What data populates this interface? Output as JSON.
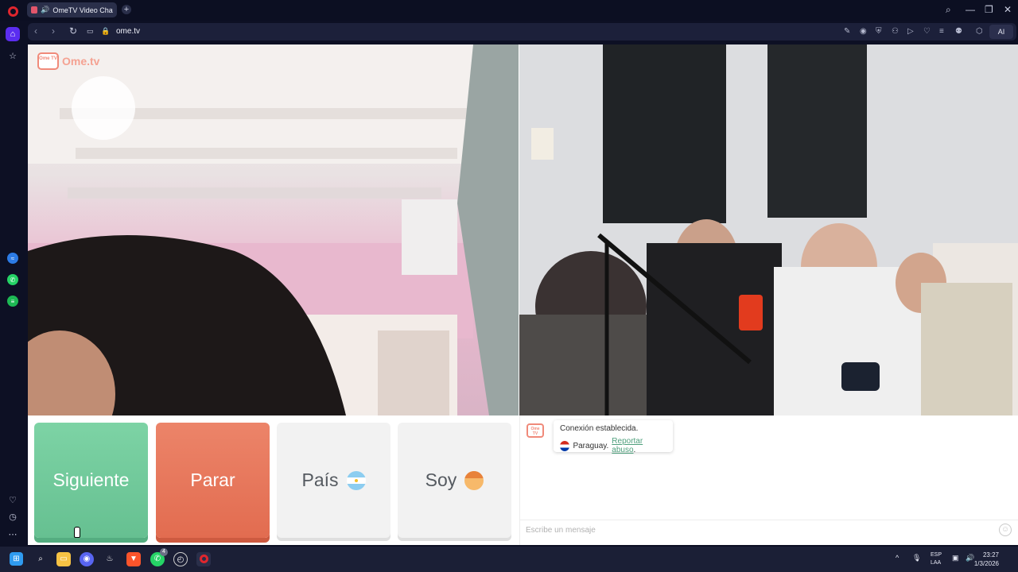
{
  "browser": {
    "tab_title": "OmeTV Video Chat -",
    "url": "ome.tv",
    "ai_label": "AI",
    "new_tab_glyph": "+"
  },
  "window_controls": {
    "search_icon": "⌕",
    "minimize_icon": "—",
    "restore_icon": "❐",
    "close_icon": "✕"
  },
  "sidebar": {
    "items": [
      "home-icon",
      "bookmarks-icon",
      "messenger-icon",
      "whatsapp-icon",
      "spotify-icon",
      "heart-icon",
      "history-icon",
      "more-icon"
    ]
  },
  "page": {
    "logo_text": "Ome.tv",
    "logo_badge": "Ome TV",
    "buttons": {
      "next": "Siguiente",
      "stop": "Parar",
      "country": "País",
      "gender": "Soy"
    },
    "chat": {
      "status_line": "Conexión establecida.",
      "country": "Paraguay.",
      "report_link": "Reportar abuso",
      "report_suffix": ".",
      "input_placeholder": "Escribe un mensaje"
    }
  },
  "taskbar": {
    "whatsapp_badge": "4",
    "language_line1": "ESP",
    "language_line2": "LAA",
    "time": "23:27",
    "date": "1/3/2026"
  },
  "colors": {
    "next": "#7dd3a5",
    "stop": "#ec8469",
    "neutral_button": "#f2f2f2",
    "opera_accent": "#5b2df0"
  }
}
